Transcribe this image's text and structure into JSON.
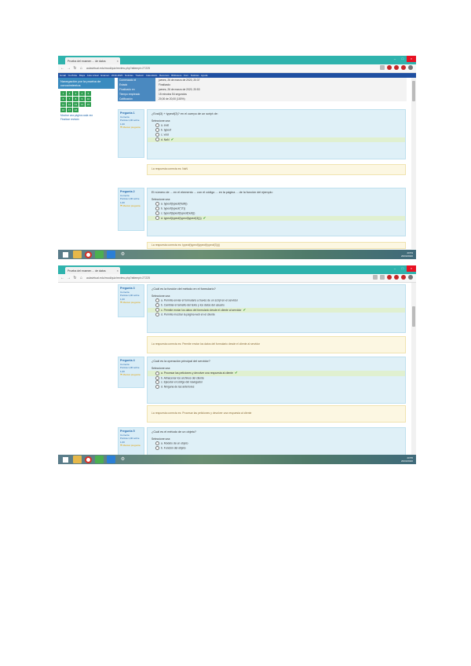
{
  "screenshot1": {
    "tab_title": "Prueba del examen ... de datos",
    "url": "aulavirtual.edu/mod/quiz/review.php?attempt=27225",
    "bookmarks": "Gmail · YouTube · Maps · Aula virtual · Examen · 2019-2020 · Noticias · Traducir · Calendario · Recursos · Biblioteca · Foro · Noticias · Ayuda",
    "nav": {
      "title": "Navegación por la prueba de conocimientos",
      "squares": [
        "1",
        "2",
        "3",
        "4",
        "5",
        "6",
        "7",
        "8",
        "9",
        "10",
        "11",
        "12",
        "13",
        "14",
        "15",
        "16",
        "17",
        "18"
      ],
      "link1": "Mostrar una página cada vez",
      "link2": "Finalizar revisión"
    },
    "summary": [
      {
        "k": "Comenzado el",
        "v": "jueves, 26 de marzo de 2020, 20:37"
      },
      {
        "k": "Estado",
        "v": "Finalizado"
      },
      {
        "k": "Finalizado en",
        "v": "jueves, 26 de marzo de 2020, 20:53"
      },
      {
        "k": "Tiempo empleado",
        "v": "15 minutos 54 segundos"
      },
      {
        "k": "Calificación",
        "v": "20,00 de 20,00 (100%)"
      }
    ],
    "q1": {
      "num": "Pregunta 1",
      "state": "Correcta",
      "mark": "Puntúa 1,00 sobre 1,00",
      "flag": "Marcar pregunta",
      "text": "¿Eval(3) + typeof(3)? en el cuerpo de un script de:",
      "select": "Seleccione una:",
      "options": [
        "a. eval",
        "b. typeof",
        "c. void",
        "d. NaN"
      ],
      "feedback": "La respuesta correcta es: NaN"
    },
    "q2": {
      "num": "Pregunta 2",
      "state": "Correcta",
      "mark": "Puntúa 1,00 sobre 1,00",
      "flag": "Marcar pregunta",
      "text": "El número de ... en el elemento ... con el código ... en la página ... de la función del ejemplo:",
      "select": "Seleccione una:",
      "options": [
        "a. typeof(typeof(NaN))",
        "b. typeof(typeof(\"3\"))",
        "c. typeof(typeof(typeof(null)))",
        "d. typeof(typeof(typeof(typeof(3))))"
      ],
      "feedback": "La respuesta correcta es: typeof(typeof(typeof(typeof(3))))"
    },
    "tray": {
      "time": "20:53",
      "date": "26/03/2020"
    }
  },
  "screenshot2": {
    "tab_title": "Prueba del examen ... de datos",
    "url": "aulavirtual.edu/mod/quiz/review.php?attempt=27225",
    "q3": {
      "num": "Pregunta 3",
      "state": "Correcta",
      "mark": "Puntúa 1,00 sobre 1,00",
      "flag": "Marcar pregunta",
      "text": "¿Cuál es la función del método en el formulario?",
      "select": "Seleccione una:",
      "options": [
        "a. Permite enviar el formulario a través de un script en el servidor",
        "b. Cambiar el tamaño del texto y los datos del usuario",
        "c. Permite enviar los datos del formulario desde el cliente al servidor",
        "d. Permite mostrar la página web en el cliente"
      ],
      "feedback": "La respuesta correcta es: Permite enviar los datos del formulario desde el cliente al servidor"
    },
    "q4": {
      "num": "Pregunta 4",
      "state": "Correcta",
      "mark": "Puntúa 1,00 sobre 1,00",
      "flag": "Marcar pregunta",
      "text": "¿Cuál es la operación principal del servidor?",
      "select": "Seleccione una:",
      "options": [
        "a. Procesar las peticiones y devolver una respuesta al cliente",
        "b. Almacenar los archivos del cliente",
        "c. Ejecutar el código del navegador",
        "d. Ninguna de las anteriores"
      ],
      "feedback": "La respuesta correcta es: Procesar las peticiones y devolver una respuesta al cliente"
    },
    "q5": {
      "num": "Pregunta 5",
      "state": "Correcta",
      "mark": "Puntúa 1,00 sobre 1,00",
      "flag": "Marcar pregunta",
      "text": "¿Cuál es el método de un objeto?",
      "select": "Seleccione una:",
      "options": [
        "a. Modelo de un objeto",
        "b. Función del objeto"
      ]
    },
    "tray": {
      "time": "20:55",
      "date": "26/03/2020"
    }
  }
}
